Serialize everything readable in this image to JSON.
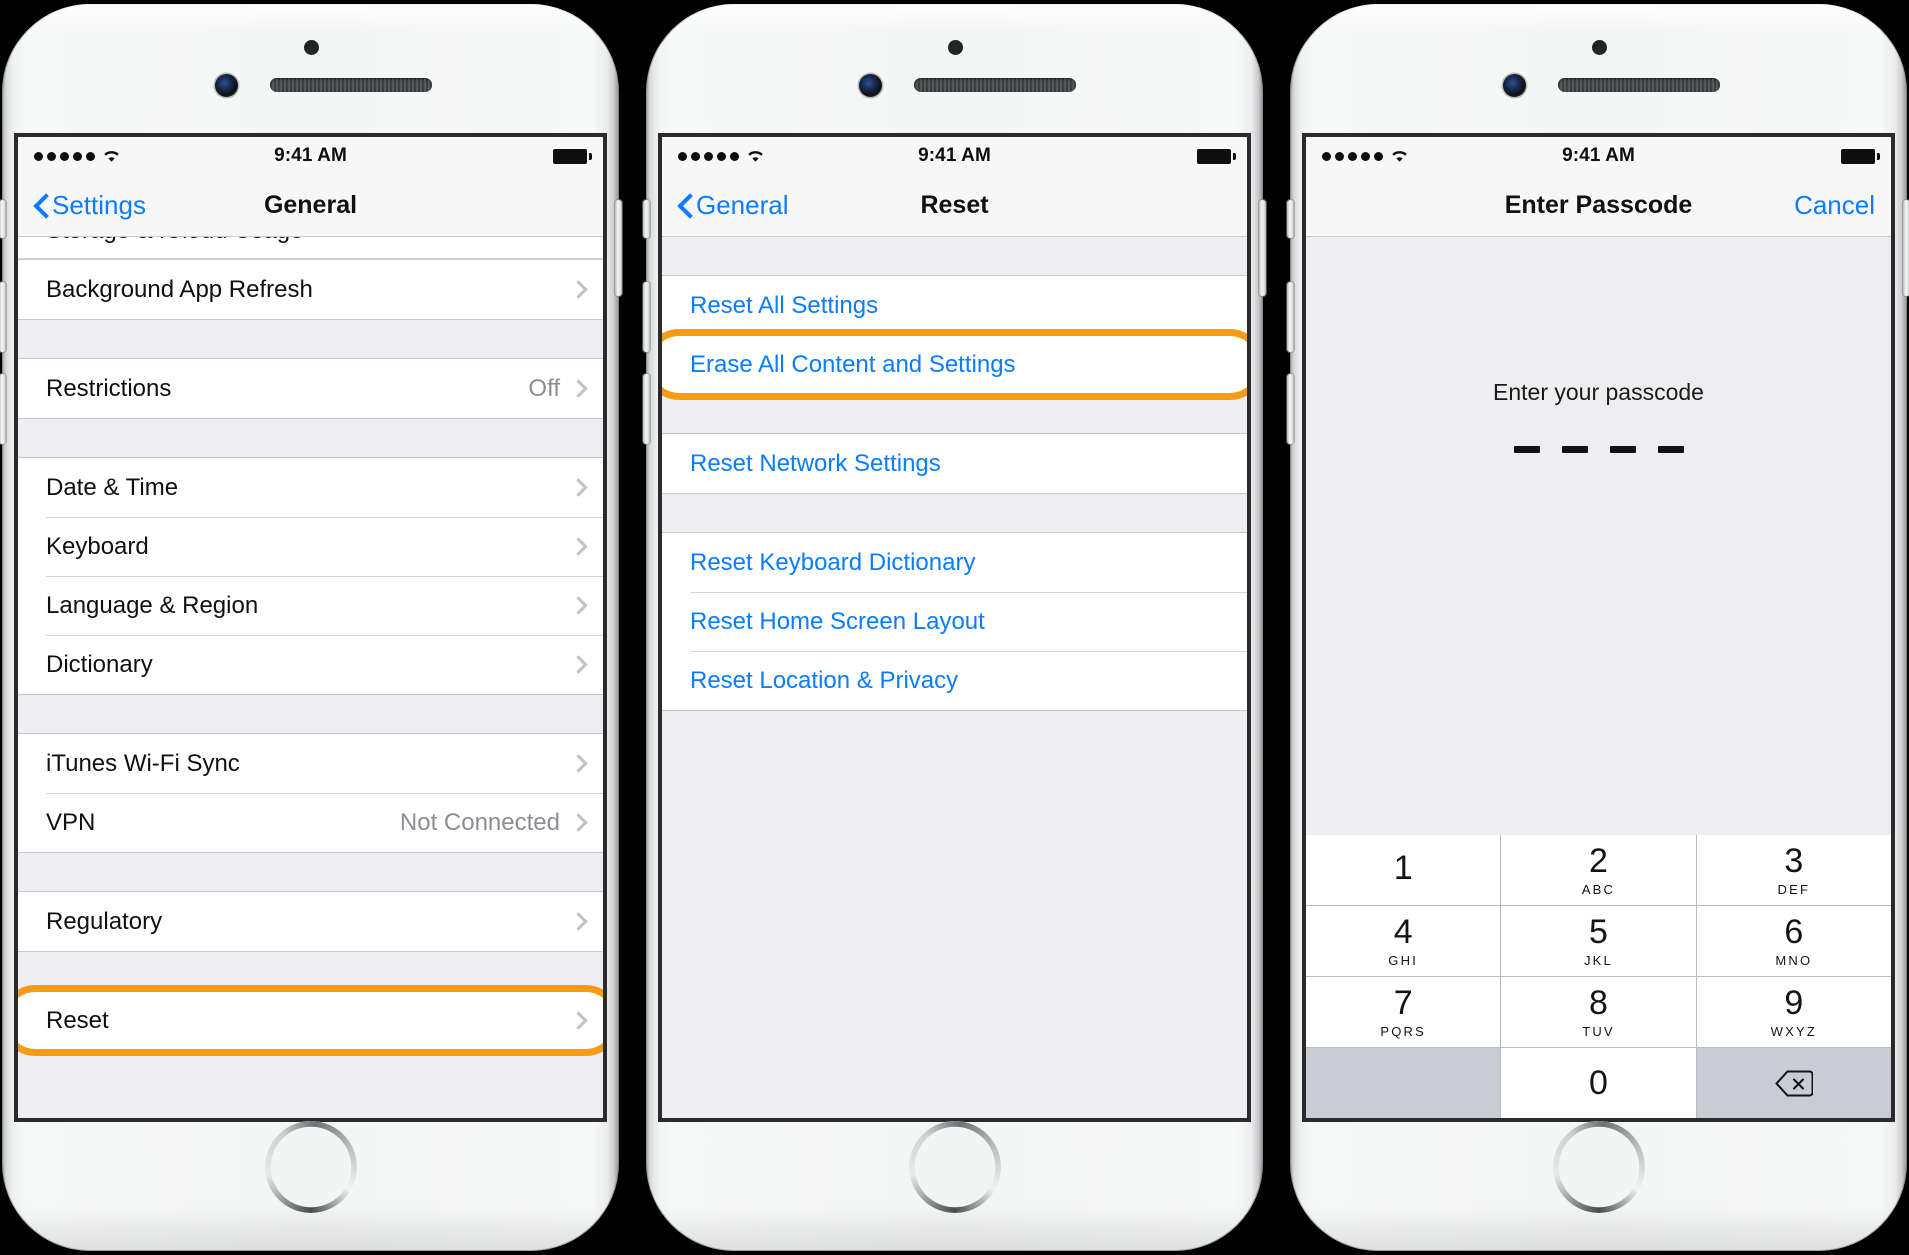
{
  "statusbar": {
    "time": "9:41 AM",
    "signal_dots": 5,
    "wifi_icon": "wifi-icon",
    "battery_icon": "battery-full-icon"
  },
  "colors": {
    "accent_blue": "#0a7cff",
    "highlight_orange": "#f59b18",
    "separator": "#d6d6da",
    "group_bg": "#eeeef1"
  },
  "screen1": {
    "nav": {
      "back_label": "Settings",
      "title": "General",
      "back_icon": "chevron-left-icon"
    },
    "clipped_row": "Storage & iCloud Usage",
    "groups": [
      {
        "rows": [
          {
            "label": "Background App Refresh",
            "value": "",
            "chevron": true
          }
        ]
      },
      {
        "rows": [
          {
            "label": "Restrictions",
            "value": "Off",
            "chevron": true
          }
        ]
      },
      {
        "rows": [
          {
            "label": "Date & Time",
            "value": "",
            "chevron": true
          },
          {
            "label": "Keyboard",
            "value": "",
            "chevron": true
          },
          {
            "label": "Language & Region",
            "value": "",
            "chevron": true
          },
          {
            "label": "Dictionary",
            "value": "",
            "chevron": true
          }
        ]
      },
      {
        "rows": [
          {
            "label": "iTunes Wi-Fi Sync",
            "value": "",
            "chevron": true
          },
          {
            "label": "VPN",
            "value": "Not Connected",
            "chevron": true
          }
        ]
      },
      {
        "rows": [
          {
            "label": "Regulatory",
            "value": "",
            "chevron": true
          }
        ]
      },
      {
        "highlighted": true,
        "rows": [
          {
            "label": "Reset",
            "value": "",
            "chevron": true
          }
        ]
      }
    ]
  },
  "screen2": {
    "nav": {
      "back_label": "General",
      "title": "Reset",
      "back_icon": "chevron-left-icon"
    },
    "groups": [
      {
        "rows": [
          {
            "label": "Reset All Settings",
            "highlighted": false
          },
          {
            "label": "Erase All Content and Settings",
            "highlighted": true
          }
        ]
      },
      {
        "rows": [
          {
            "label": "Reset Network Settings",
            "highlighted": false
          }
        ]
      },
      {
        "rows": [
          {
            "label": "Reset Keyboard Dictionary",
            "highlighted": false
          },
          {
            "label": "Reset Home Screen Layout",
            "highlighted": false
          },
          {
            "label": "Reset Location & Privacy",
            "highlighted": false
          }
        ]
      }
    ]
  },
  "screen3": {
    "nav": {
      "title": "Enter Passcode",
      "cancel_label": "Cancel"
    },
    "prompt": "Enter your passcode",
    "passcode_length": 4,
    "keypad": [
      {
        "num": "1",
        "sub": ""
      },
      {
        "num": "2",
        "sub": "ABC"
      },
      {
        "num": "3",
        "sub": "DEF"
      },
      {
        "num": "4",
        "sub": "GHI"
      },
      {
        "num": "5",
        "sub": "JKL"
      },
      {
        "num": "6",
        "sub": "MNO"
      },
      {
        "num": "7",
        "sub": "PQRS"
      },
      {
        "num": "8",
        "sub": "TUV"
      },
      {
        "num": "9",
        "sub": "WXYZ"
      },
      {
        "num": "",
        "sub": "",
        "type": "blank"
      },
      {
        "num": "0",
        "sub": ""
      },
      {
        "num": "",
        "sub": "",
        "type": "delete",
        "icon": "backspace-icon"
      }
    ]
  }
}
